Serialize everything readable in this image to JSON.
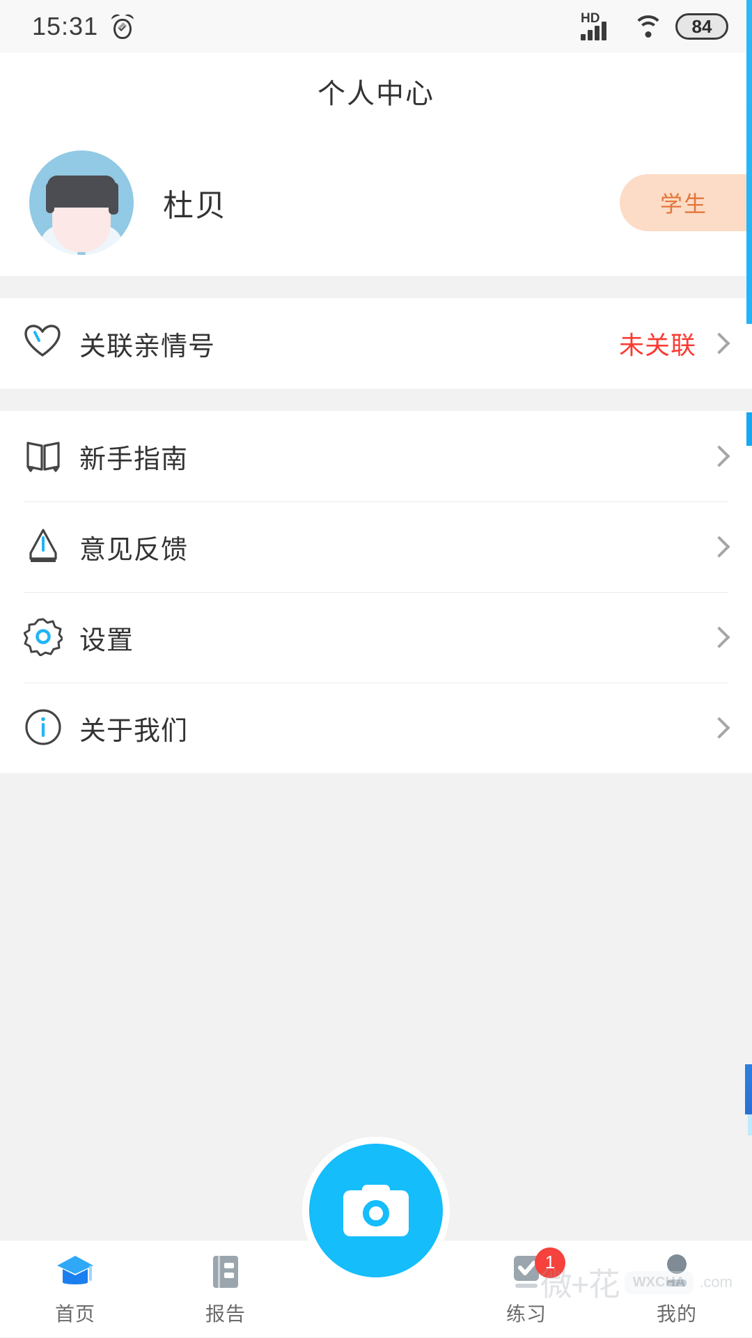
{
  "statusbar": {
    "time": "15:31",
    "alarm_icon": "alarm-clock-icon",
    "network_label": "HD",
    "signal_icon": "signal-bars-icon",
    "wifi_icon": "wifi-icon",
    "battery_level": "84"
  },
  "header": {
    "title": "个人中心"
  },
  "profile": {
    "avatar_icon": "user-avatar-illustration",
    "name": "杜贝",
    "role_badge": "学生",
    "badge_bg": "#fcdcc6",
    "badge_color": "#e2763c"
  },
  "groups": [
    {
      "rows": [
        {
          "icon": "heart-icon",
          "label": "关联亲情号",
          "status": "未关联",
          "status_color": "#fa3b33",
          "chevron": "chevron-right-icon"
        }
      ]
    },
    {
      "rows": [
        {
          "icon": "book-icon",
          "label": "新手指南",
          "status": "",
          "chevron": "chevron-right-icon"
        },
        {
          "icon": "pen-icon",
          "label": "意见反馈",
          "status": "",
          "chevron": "chevron-right-icon"
        },
        {
          "icon": "gear-icon",
          "label": "设置",
          "status": "",
          "chevron": "chevron-right-icon"
        },
        {
          "icon": "info-icon",
          "label": "关于我们",
          "status": "",
          "chevron": "chevron-right-icon"
        }
      ]
    }
  ],
  "bottom_nav": {
    "tabs": [
      {
        "icon": "graduation-cap-icon",
        "label": "首页",
        "active": true,
        "badge": ""
      },
      {
        "icon": "report-book-icon",
        "label": "报告",
        "active": false,
        "badge": ""
      },
      {
        "icon": "camera-icon",
        "label": "",
        "active": false,
        "badge": ""
      },
      {
        "icon": "checkbox-icon",
        "label": "练习",
        "active": false,
        "badge": "1"
      },
      {
        "icon": "person-icon",
        "label": "我的",
        "active": false,
        "badge": ""
      }
    ],
    "fab_icon": "camera-icon",
    "accent_color": "#15bdfb"
  },
  "watermark": {
    "cn": "微+花",
    "bubble": "WXCHA",
    "domain": ".com"
  }
}
